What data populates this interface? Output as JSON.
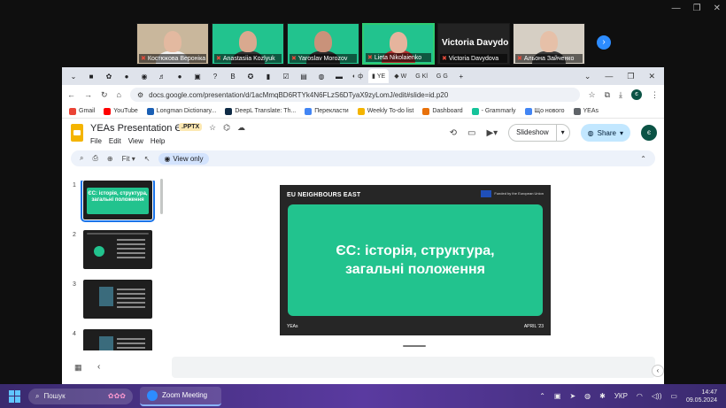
{
  "zoom": {
    "window_controls": [
      "—",
      "❐",
      "✕"
    ],
    "participants": [
      {
        "name": "Костюкова Вероніка",
        "bg": "#c9b79c",
        "face": "#e3b9a0",
        "body": "#f2f2f2",
        "active": false
      },
      {
        "name": "Anastasiia Kozlyuk",
        "bg": "#22c38e",
        "face": "#d9a98f",
        "body": "#333333",
        "active": false
      },
      {
        "name": "Yaroslav Morozov",
        "bg": "#22c38e",
        "face": "#c9927a",
        "body": "#2a2a2a",
        "active": false
      },
      {
        "name": "Lieta Nikolaienko",
        "bg": "#22c38e",
        "face": "#e5b49d",
        "body": "#b03030",
        "active": true
      },
      {
        "name": "Victoria Davydova",
        "bg": "#232323",
        "face": "",
        "body": "",
        "active": false,
        "big_name": "Victoria Davydo..."
      },
      {
        "name": "Альона Зайченко",
        "bg": "#d6cfc4",
        "face": "#e6c0a8",
        "body": "#3b3b3b",
        "active": false
      }
    ],
    "next_arrow": "›"
  },
  "browser": {
    "tabs": [
      {
        "label": "",
        "icon": "⌄"
      },
      {
        "label": "",
        "icon": "■"
      },
      {
        "label": "",
        "icon": "✿"
      },
      {
        "label": "",
        "icon": "●"
      },
      {
        "label": "",
        "icon": "◉"
      },
      {
        "label": "",
        "icon": "♬"
      },
      {
        "label": "",
        "icon": "●"
      },
      {
        "label": "",
        "icon": "▣"
      },
      {
        "label": "",
        "icon": "?"
      },
      {
        "label": "",
        "icon": "B"
      },
      {
        "label": "",
        "icon": "✪"
      },
      {
        "label": "",
        "icon": "▮"
      },
      {
        "label": "",
        "icon": "☑"
      },
      {
        "label": "",
        "icon": "▤"
      },
      {
        "label": "",
        "icon": "◍"
      },
      {
        "label": "",
        "icon": "▬"
      },
      {
        "label": "ф",
        "icon": "◐"
      },
      {
        "label": "YE",
        "icon": "▮"
      },
      {
        "label": "W",
        "icon": "◆"
      },
      {
        "label": "Kl",
        "icon": "G"
      },
      {
        "label": "G",
        "icon": "G"
      }
    ],
    "new_tab": "+",
    "window_buttons": [
      "⌄",
      "—",
      "❐",
      "✕"
    ],
    "url": "docs.google.com/presentation/d/1acMmqBD6RTYk4N6FLzS6DTyaX9zyLomJ/edit#slide=id.p20",
    "profile_letter": "є",
    "bookmarks": [
      {
        "label": "Gmail",
        "color": "#ea4335"
      },
      {
        "label": "YouTube",
        "color": "#ff0000"
      },
      {
        "label": "Longman Dictionary...",
        "color": "#1a5fb4"
      },
      {
        "label": "DeepL Translate: Th...",
        "color": "#0f2b46"
      },
      {
        "label": "Перекласти",
        "color": "#4285f4"
      },
      {
        "label": "Weekly To-do list",
        "color": "#f4b400"
      },
      {
        "label": "Dashboard",
        "color": "#e8710a"
      },
      {
        "label": "- Grammarly",
        "color": "#15c39a"
      },
      {
        "label": "Що нового",
        "color": "#4285f4"
      },
      {
        "label": "YEAs",
        "color": "#5f6368"
      }
    ]
  },
  "slides": {
    "title": "YEAs Presentation ЄС",
    "badge": ".PPTX",
    "menus": [
      "File",
      "Edit",
      "View",
      "Help"
    ],
    "slideshow_label": "Slideshow",
    "share_label": "Share",
    "avatar_letter": "є",
    "zoom_label": "Fit",
    "view_only_label": "View only",
    "thumbnails": [
      {
        "num": "1",
        "title": "ЄС: історія, структура, загальні положення",
        "selected": true
      },
      {
        "num": "2",
        "title": "",
        "selected": false
      },
      {
        "num": "3",
        "title": "",
        "selected": false
      },
      {
        "num": "4",
        "title": "",
        "selected": false
      }
    ],
    "current_slide": {
      "brand": "EU NEIGHBOURS EAST",
      "eu_text": "Funded by the European Union",
      "headline": "ЄС: історія, структура, загальні положення",
      "footer_left": "YEAs",
      "footer_right": "APRIL '23"
    }
  },
  "taskbar": {
    "search_placeholder": "Пошук",
    "app_label": "Zoom Meeting",
    "lang": "УКР",
    "time": "14:47",
    "date": "09.05.2024"
  }
}
